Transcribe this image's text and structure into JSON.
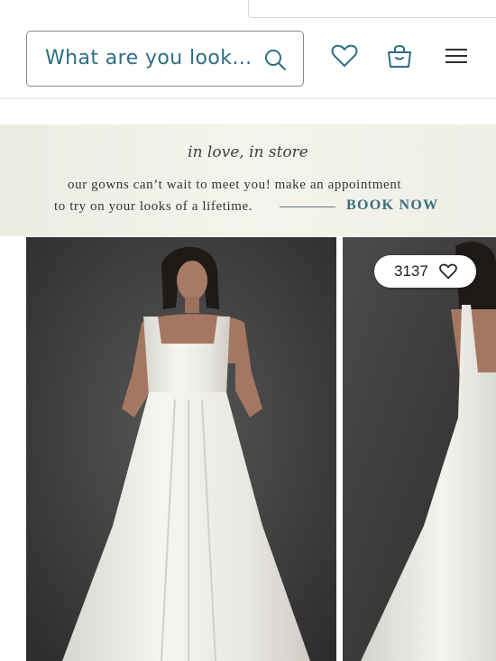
{
  "search": {
    "placeholder": "What are you look..."
  },
  "header": {
    "icons": [
      "search-icon",
      "heart-icon",
      "shopping-bag-icon",
      "menu-icon"
    ]
  },
  "promo": {
    "title": "in love, in store",
    "line1": "our gowns can’t wait to meet you! make an appointment",
    "line2": "to try on your looks of a lifetime.",
    "cta": "BOOK NOW"
  },
  "products": [
    {
      "image": "model-in-white-square-neck-gown-front"
    },
    {
      "image": "model-in-white-gown-back-view",
      "favorites": "3137"
    }
  ],
  "colors": {
    "accent": "#2e6f83",
    "cta": "#3b6e80",
    "promo_bg": "#f1f0e9",
    "photo_bg": "#3a3a3a"
  }
}
